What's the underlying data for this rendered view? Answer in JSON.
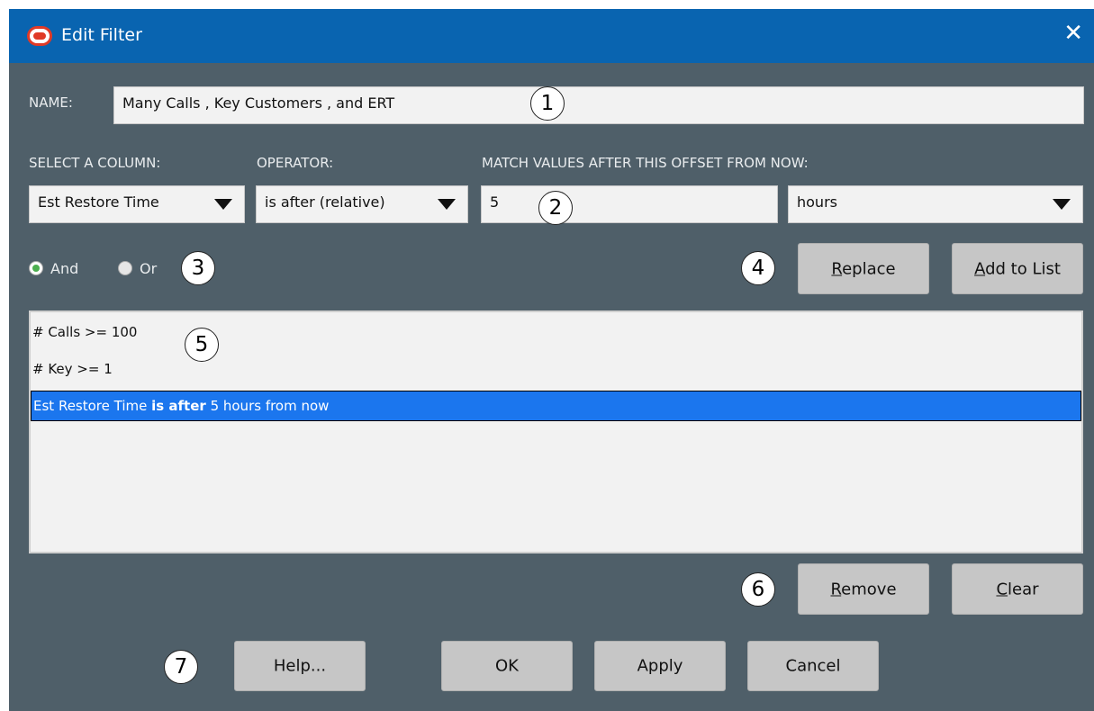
{
  "window": {
    "title": "Edit Filter",
    "close_glyph": "✕"
  },
  "name_row": {
    "label": "NAME:",
    "value": "Many Calls , Key Customers , and ERT"
  },
  "column": {
    "label": "SELECT A COLUMN:",
    "value": "Est Restore Time"
  },
  "operator": {
    "label": "OPERATOR:",
    "value": "is after (relative)"
  },
  "offset": {
    "label": "MATCH VALUES AFTER THIS OFFSET FROM NOW:",
    "value": "5",
    "unit": "hours"
  },
  "logic": {
    "and_label": "And",
    "or_label": "Or",
    "selected": "And"
  },
  "buttons": {
    "replace_mnemonic": "R",
    "replace_rest": "eplace",
    "add_mnemonic": "A",
    "add_rest": "dd to List",
    "remove_mnemonic": "R",
    "remove_rest": "emove",
    "clear_mnemonic": "C",
    "clear_rest": "lear",
    "help": "Help...",
    "ok": "OK",
    "apply": "Apply",
    "cancel": "Cancel"
  },
  "conditions": [
    {
      "text": "# Calls >= 100"
    },
    {
      "text": "# Key >= 1"
    },
    {
      "pre": "Est Restore Time ",
      "bold": "is after",
      "post": " 5 hours from now",
      "selected": true
    }
  ],
  "markers": [
    "1",
    "2",
    "3",
    "4",
    "5",
    "6",
    "7"
  ],
  "colors": {
    "titlebar": "#0964b0",
    "dialog_bg": "#4f5f69",
    "selection": "#1b76ee",
    "radio_checked": "#4caf50"
  }
}
